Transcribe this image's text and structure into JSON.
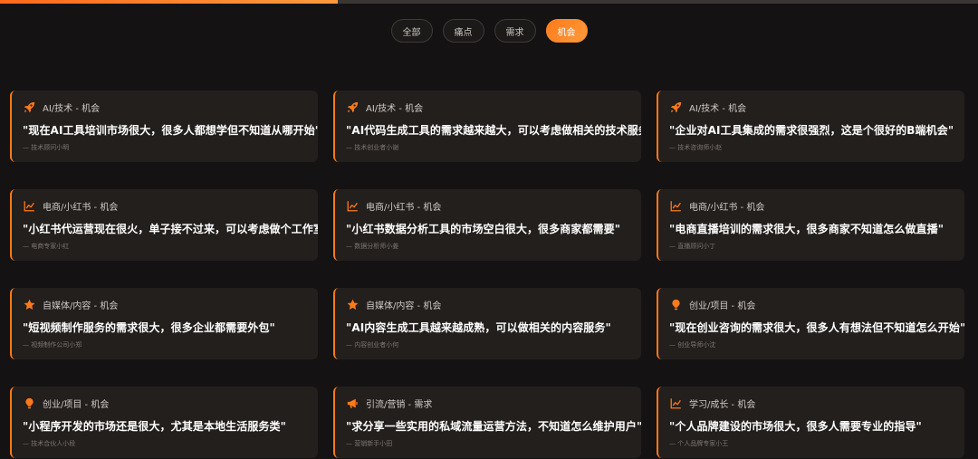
{
  "progress": {
    "fraction": 0.345,
    "color": "#ff7a1a"
  },
  "filters": [
    {
      "label": "全部",
      "active": false
    },
    {
      "label": "痛点",
      "active": false
    },
    {
      "label": "需求",
      "active": false
    },
    {
      "label": "机会",
      "active": true
    }
  ],
  "cards": [
    {
      "icon": "rocket-icon",
      "tag": "AI/技术 - 机会",
      "quote": "\"现在AI工具培训市场很大，很多人都想学但不知道从哪开始\"",
      "author": "— 技术顾问小明"
    },
    {
      "icon": "rocket-icon",
      "tag": "AI/技术 - 机会",
      "quote": "\"AI代码生成工具的需求越来越大，可以考虑做相关的技术服务\"",
      "author": "— 技术创业者小谢"
    },
    {
      "icon": "rocket-icon",
      "tag": "AI/技术 - 机会",
      "quote": "\"企业对AI工具集成的需求很强烈，这是个很好的B端机会\"",
      "author": "— 技术咨询师小赵"
    },
    {
      "icon": "chart-line-icon",
      "tag": "电商/小红书 - 机会",
      "quote": "\"小红书代运营现在很火，单子接不过来，可以考虑做个工作室\"",
      "author": "— 电商专家小红"
    },
    {
      "icon": "chart-line-icon",
      "tag": "电商/小红书 - 机会",
      "quote": "\"小红书数据分析工具的市场空白很大，很多商家都需要\"",
      "author": "— 数据分析师小姜"
    },
    {
      "icon": "chart-line-icon",
      "tag": "电商/小红书 - 机会",
      "quote": "\"电商直播培训的需求很大，很多商家不知道怎么做直播\"",
      "author": "— 直播顾问小丁"
    },
    {
      "icon": "star-icon",
      "tag": "自媒体/内容 - 机会",
      "quote": "\"短视频制作服务的需求很大，很多企业都需要外包\"",
      "author": "— 视频制作公司小郑"
    },
    {
      "icon": "star-icon",
      "tag": "自媒体/内容 - 机会",
      "quote": "\"AI内容生成工具越来越成熟，可以做相关的内容服务\"",
      "author": "— 内容创业者小何"
    },
    {
      "icon": "lightbulb-icon",
      "tag": "创业/项目 - 机会",
      "quote": "\"现在创业咨询的需求很大，很多人有想法但不知道怎么开始\"",
      "author": "— 创业导师小沈"
    },
    {
      "icon": "lightbulb-icon",
      "tag": "创业/项目 - 机会",
      "quote": "\"小程序开发的市场还是很大，尤其是本地生活服务类\"",
      "author": "— 技术合伙人小段"
    },
    {
      "icon": "megaphone-icon",
      "tag": "引流/营销 - 需求",
      "quote": "\"求分享一些实用的私域流量运营方法，不知道怎么维护用户\"",
      "author": "— 营销新手小田"
    },
    {
      "icon": "chart-line-icon",
      "tag": "学习/成长 - 机会",
      "quote": "\"个人品牌建设的市场很大，很多人需要专业的指导\"",
      "author": "— 个人品牌专家小王"
    }
  ]
}
